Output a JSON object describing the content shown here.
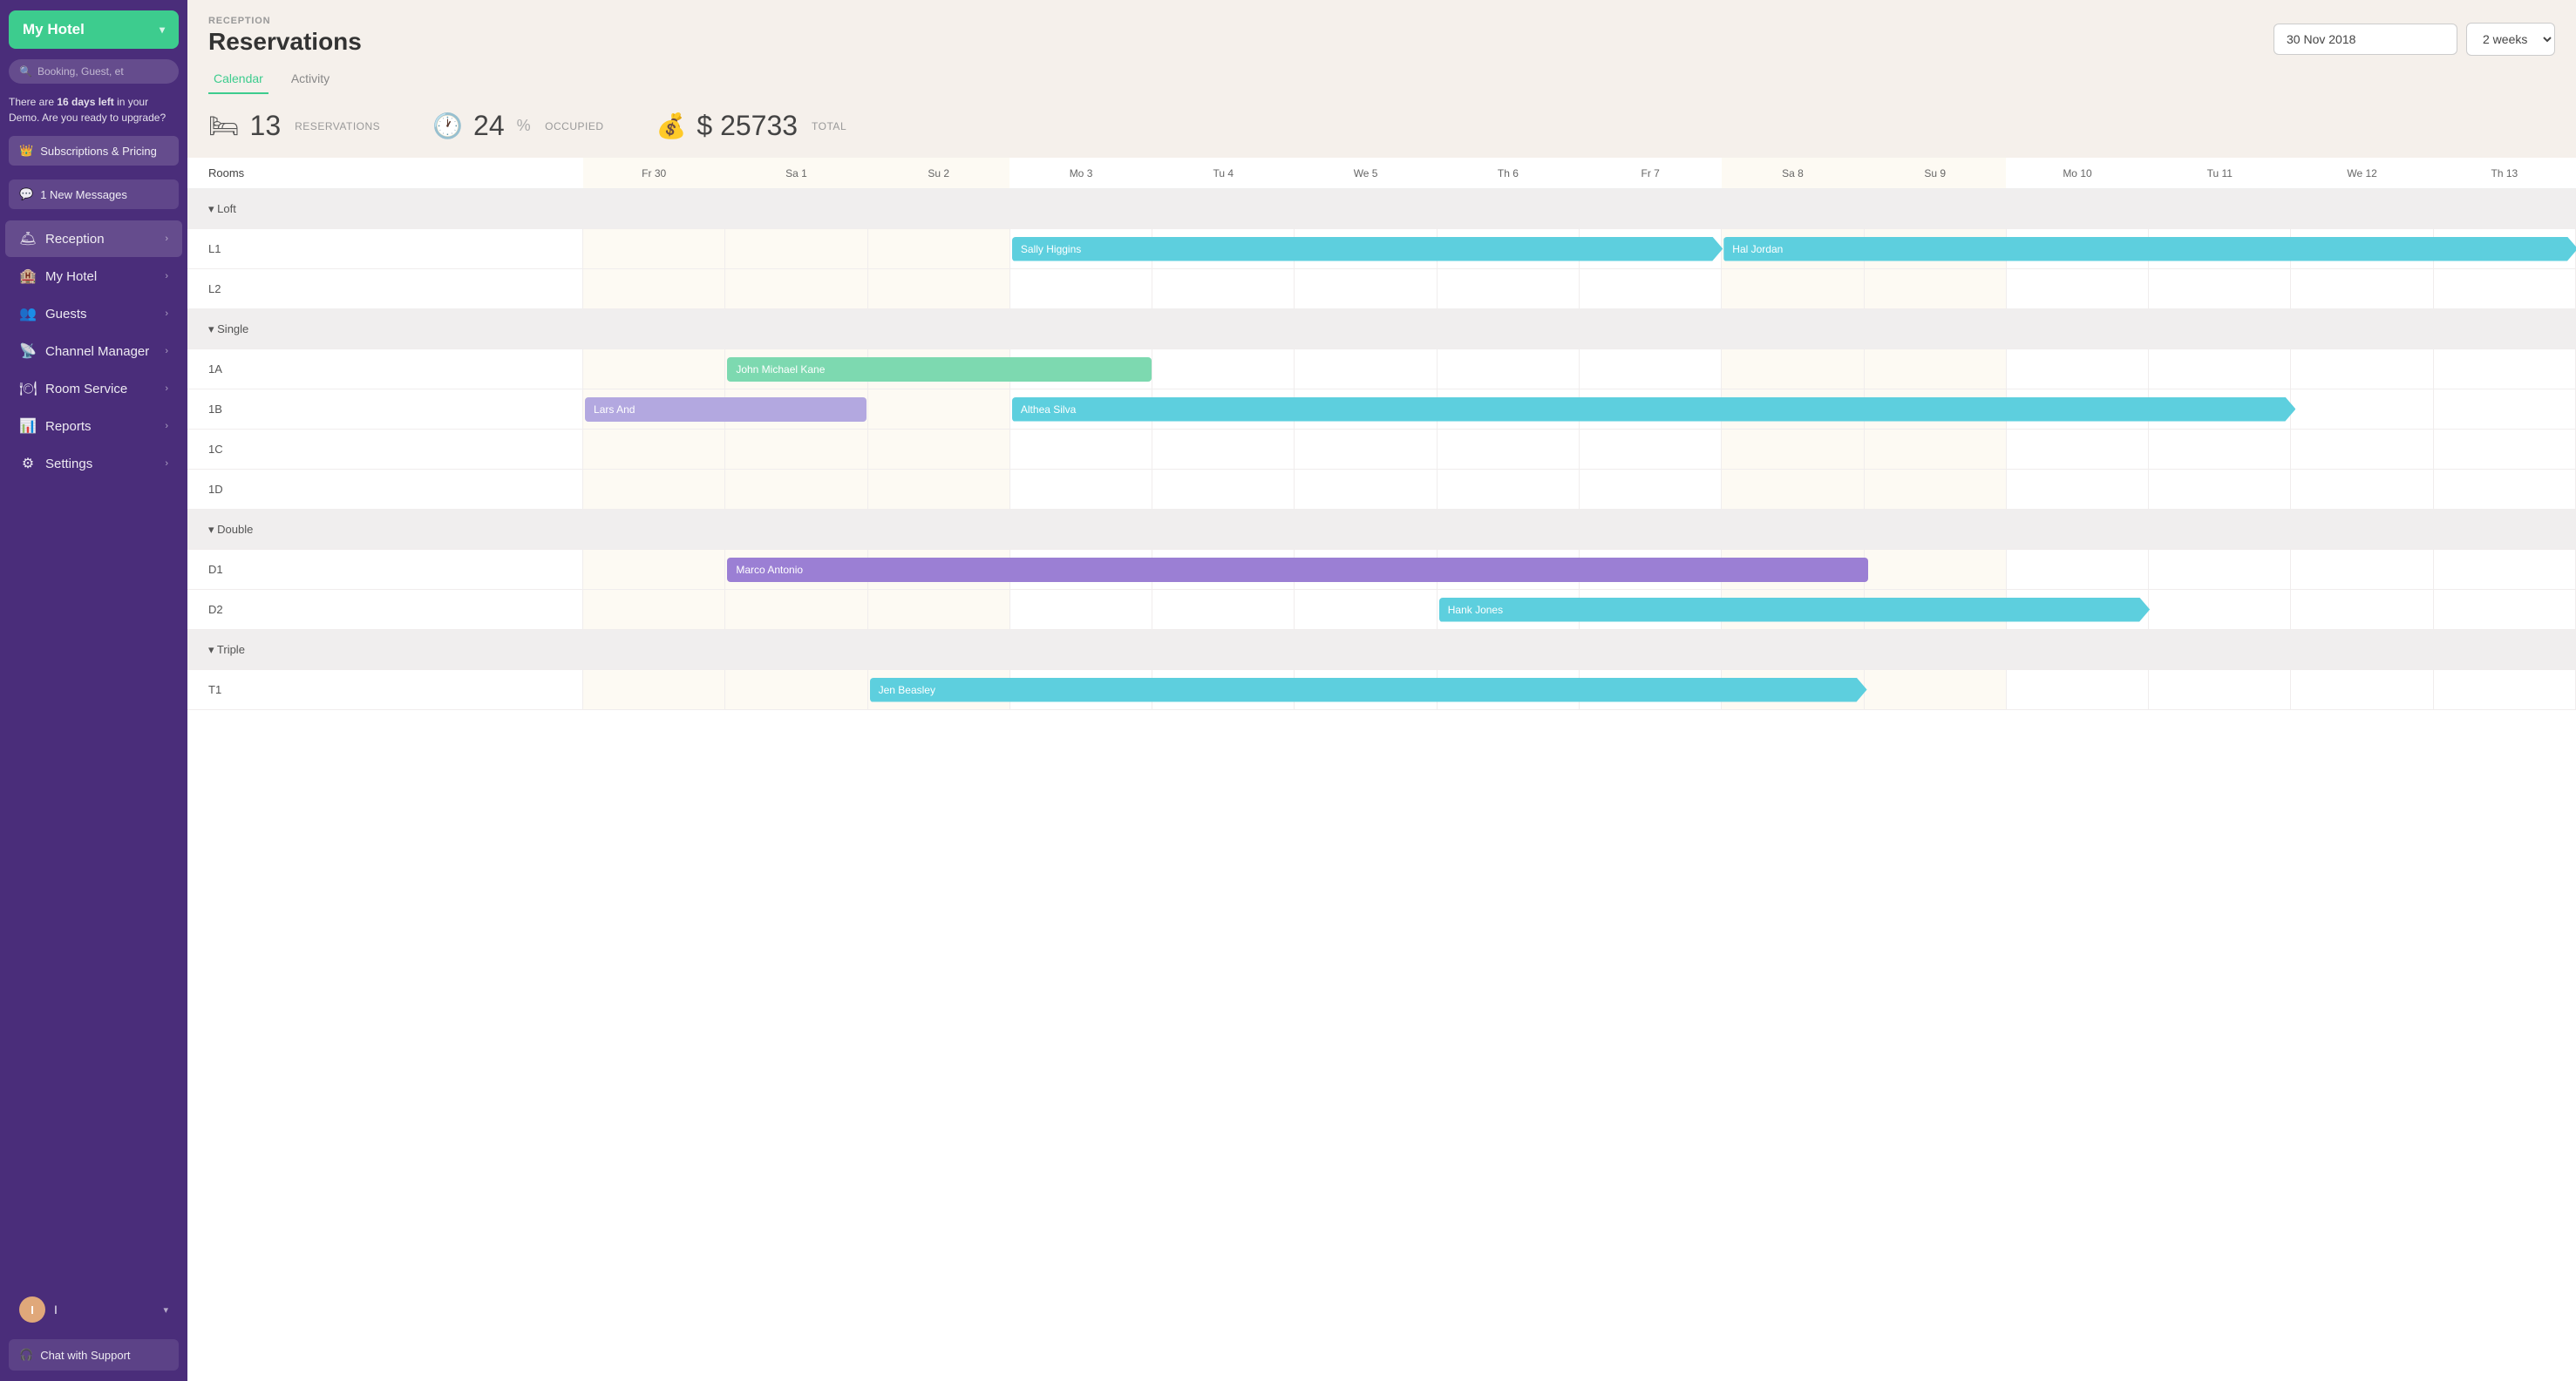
{
  "sidebar": {
    "hotel_name": "My Hotel",
    "search_placeholder": "Booking, Guest, et",
    "demo_notice": "There are ",
    "demo_days": "16 days left",
    "demo_notice2": " in your Demo. Are you ready to upgrade?",
    "upgrade_label": "Subscriptions & Pricing",
    "messages_label": "1 New Messages",
    "nav": [
      {
        "id": "reception",
        "label": "Reception",
        "icon": "🛎"
      },
      {
        "id": "my-hotel",
        "label": "My Hotel",
        "icon": "🏨"
      },
      {
        "id": "guests",
        "label": "Guests",
        "icon": "👥"
      },
      {
        "id": "channel-manager",
        "label": "Channel Manager",
        "icon": "📡"
      },
      {
        "id": "room-service",
        "label": "Room Service",
        "icon": "🍽"
      },
      {
        "id": "reports",
        "label": "Reports",
        "icon": "📊"
      },
      {
        "id": "settings",
        "label": "Settings",
        "icon": "⚙"
      }
    ],
    "user_initial": "I",
    "chat_label": "Chat with Support"
  },
  "header": {
    "section_label": "RECEPTION",
    "title": "Reservations",
    "date_value": "30 Nov 2018",
    "week_option": "2 weeks"
  },
  "tabs": [
    {
      "id": "calendar",
      "label": "Calendar"
    },
    {
      "id": "activity",
      "label": "Activity"
    }
  ],
  "stats": {
    "reservations_count": "13",
    "reservations_label": "RESERVATIONS",
    "occupied_percent": "24",
    "occupied_label": "OCCUPIED",
    "total_amount": "$ 25733",
    "total_label": "TOTAL"
  },
  "calendar": {
    "rooms_col_label": "Rooms",
    "days": [
      {
        "label": "Fr 30",
        "weekend": true
      },
      {
        "label": "Sa 1",
        "weekend": true
      },
      {
        "label": "Su 2",
        "weekend": true
      },
      {
        "label": "Mo 3",
        "weekend": false
      },
      {
        "label": "Tu 4",
        "weekend": false
      },
      {
        "label": "We 5",
        "weekend": false
      },
      {
        "label": "Th 6",
        "weekend": false
      },
      {
        "label": "Fr 7",
        "weekend": false
      },
      {
        "label": "Sa 8",
        "weekend": true
      },
      {
        "label": "Su 9",
        "weekend": true
      },
      {
        "label": "Mo 10",
        "weekend": false
      },
      {
        "label": "Tu 11",
        "weekend": false
      },
      {
        "label": "We 12",
        "weekend": false
      },
      {
        "label": "Th 13",
        "weekend": false
      }
    ],
    "sections": [
      {
        "name": "Loft",
        "rooms": [
          {
            "id": "L1",
            "bookings": [
              {
                "guest": "Sally Higgins",
                "start": 3,
                "end": 8,
                "color": "cyan"
              },
              {
                "guest": "Hal Jordan",
                "start": 8,
                "end": 14,
                "color": "cyan"
              }
            ]
          },
          {
            "id": "L2",
            "bookings": []
          }
        ]
      },
      {
        "name": "Single",
        "rooms": [
          {
            "id": "1A",
            "bookings": [
              {
                "guest": "John Michael Kane",
                "start": 1,
                "end": 4,
                "color": "green"
              }
            ]
          },
          {
            "id": "1B",
            "bookings": [
              {
                "guest": "Lars And",
                "start": 0,
                "end": 2,
                "color": "lavender"
              },
              {
                "guest": "Althea Silva",
                "start": 3,
                "end": 12,
                "color": "cyan"
              }
            ]
          },
          {
            "id": "1C",
            "bookings": []
          },
          {
            "id": "1D",
            "bookings": []
          }
        ]
      },
      {
        "name": "Double",
        "rooms": [
          {
            "id": "D1",
            "bookings": [
              {
                "guest": "Marco Antonio",
                "start": 1,
                "end": 9,
                "color": "purple"
              }
            ]
          },
          {
            "id": "D2",
            "bookings": [
              {
                "guest": "Hank Jones",
                "start": 6,
                "end": 11,
                "color": "cyan"
              }
            ]
          }
        ]
      },
      {
        "name": "Triple",
        "rooms": [
          {
            "id": "T1",
            "bookings": [
              {
                "guest": "Jen Beasley",
                "start": 2,
                "end": 9,
                "color": "cyan"
              }
            ]
          }
        ]
      }
    ]
  }
}
